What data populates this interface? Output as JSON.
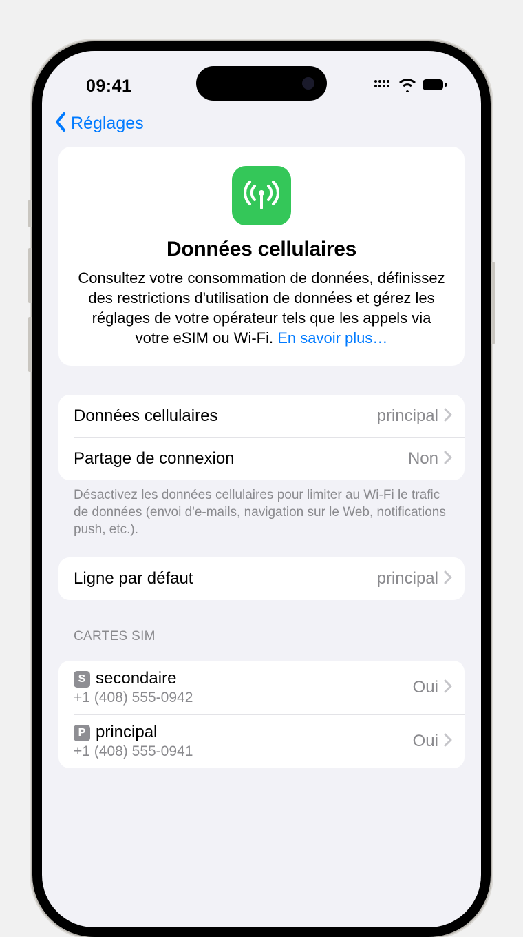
{
  "status": {
    "time": "09:41"
  },
  "nav": {
    "back_label": "Réglages"
  },
  "hero": {
    "title": "Données cellulaires",
    "description": "Consultez votre consommation de données, définissez des restrictions d'utilisation de données et gérez les réglages de votre opérateur tels que les appels via votre eSIM ou Wi-Fi. ",
    "link": "En savoir plus…"
  },
  "settings_group1": [
    {
      "label": "Données cellulaires",
      "value": "principal"
    },
    {
      "label": "Partage de connexion",
      "value": "Non"
    }
  ],
  "group1_footer": "Désactivez les données cellulaires pour limiter au Wi-Fi le trafic de données (envoi d'e-mails, navigation sur le Web, notifications push, etc.).",
  "settings_group2": [
    {
      "label": "Ligne par défaut",
      "value": "principal"
    }
  ],
  "sim_section_header": "CARTES SIM",
  "sims": [
    {
      "badge": "S",
      "name": "secondaire",
      "number": "+1 (408) 555-0942",
      "value": "Oui"
    },
    {
      "badge": "P",
      "name": "principal",
      "number": "+1 (408) 555-0941",
      "value": "Oui"
    }
  ]
}
